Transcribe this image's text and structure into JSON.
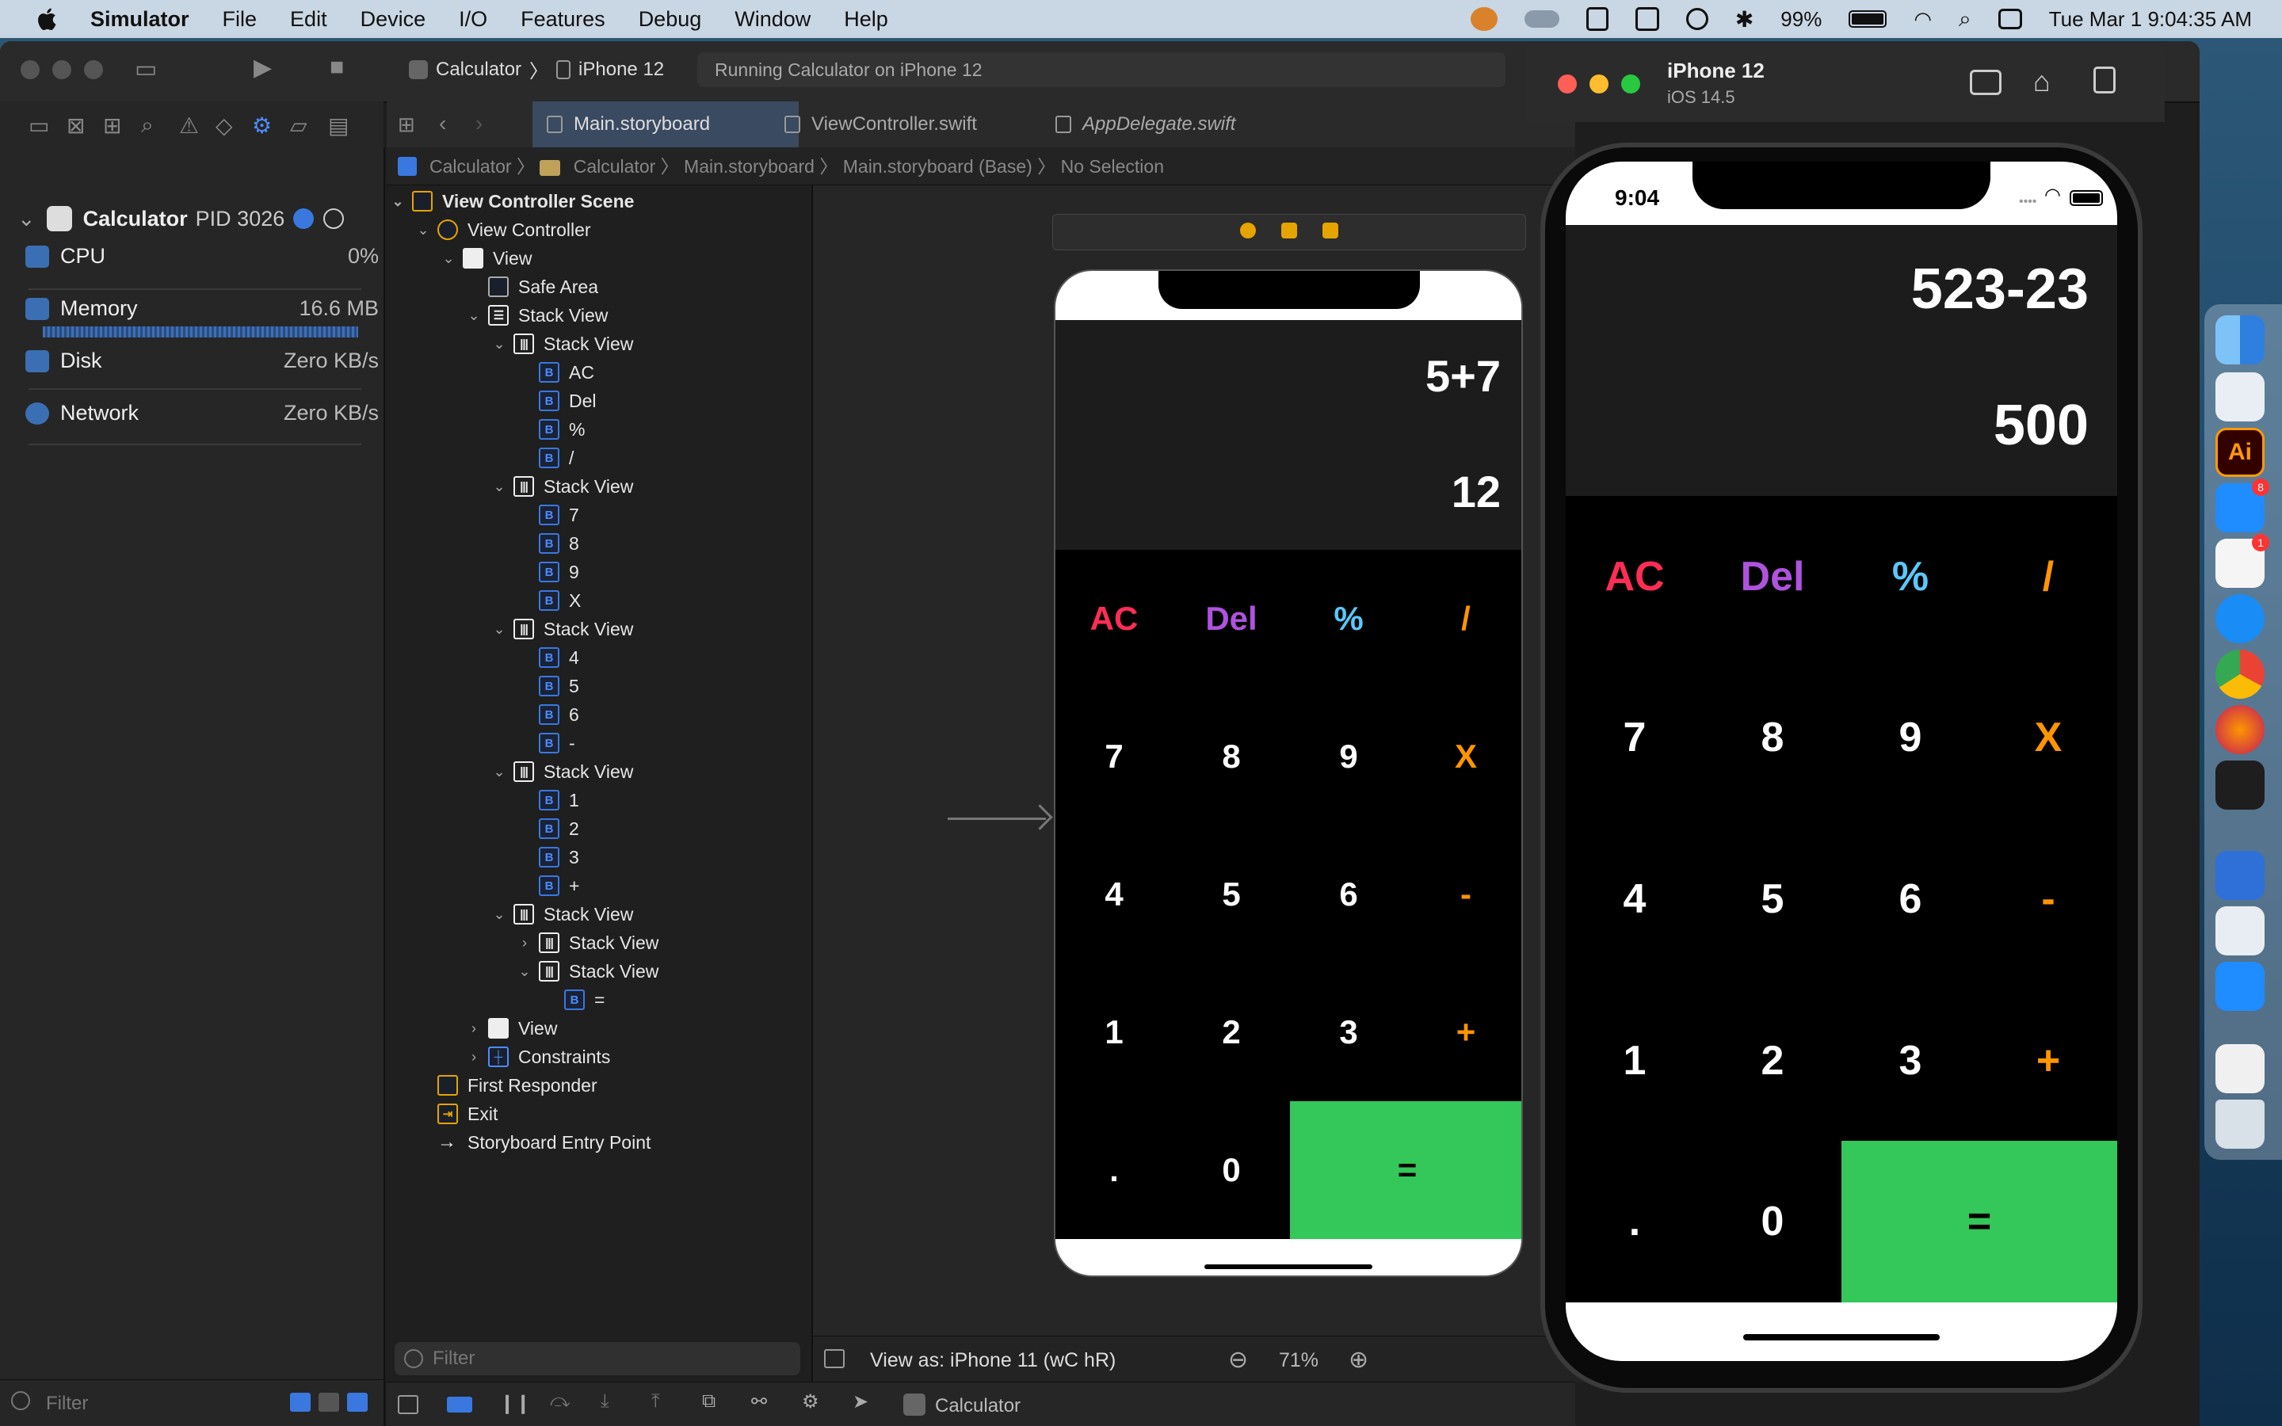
{
  "menubar": {
    "app_name": "Simulator",
    "items": [
      "File",
      "Edit",
      "Device",
      "I/O",
      "Features",
      "Debug",
      "Window",
      "Help"
    ],
    "battery": "99%",
    "datetime": "Tue Mar 1  9:04:35 AM"
  },
  "xcode": {
    "scheme": "Calculator",
    "destination": "iPhone 12",
    "activity": "Running Calculator on iPhone 12",
    "tabs": [
      {
        "label": "Main.storyboard"
      },
      {
        "label": "ViewController.swift"
      },
      {
        "label": "AppDelegate.swift"
      }
    ],
    "breadcrumb": [
      "Calculator",
      "Calculator",
      "Main.storyboard",
      "Main.storyboard (Base)",
      "No Selection"
    ],
    "debug": {
      "process": "Calculator",
      "pid": "PID 3026",
      "gauges": [
        {
          "name": "CPU",
          "value": "0%"
        },
        {
          "name": "Memory",
          "value": "16.6 MB"
        },
        {
          "name": "Disk",
          "value": "Zero KB/s"
        },
        {
          "name": "Network",
          "value": "Zero KB/s"
        }
      ]
    },
    "filter_placeholder": "Filter",
    "outline": {
      "scene": "View Controller Scene",
      "view_controller": "View Controller",
      "view": "View",
      "safe_area": "Safe Area",
      "stack_view": "Stack View",
      "rows": [
        [
          "AC",
          "Del",
          "%",
          "/"
        ],
        [
          "7",
          "8",
          "9",
          "X"
        ],
        [
          "4",
          "5",
          "6",
          "-"
        ],
        [
          "1",
          "2",
          "3",
          "+"
        ]
      ],
      "equals": "=",
      "constraints": "Constraints",
      "first_responder": "First Responder",
      "exit": "Exit",
      "entry_point": "Storyboard Entry Point",
      "b_glyph": "B"
    },
    "canvas": {
      "expression": "5+7",
      "result": "12",
      "view_as": "View as: iPhone 11 (wC hR)",
      "zoom": "71%"
    },
    "debug_bar_target": "Calculator"
  },
  "simulator": {
    "device": "iPhone 12",
    "os": "iOS 14.5",
    "time": "9:04",
    "expression": "523-23",
    "result": "500"
  },
  "keypad": {
    "rows": [
      [
        {
          "label": "AC",
          "color": "#ff2d55"
        },
        {
          "label": "Del",
          "color": "#af52de"
        },
        {
          "label": "%",
          "color": "#5ac8fa"
        },
        {
          "label": "/",
          "color": "#ff9500"
        }
      ],
      [
        {
          "label": "7",
          "color": "#ffffff"
        },
        {
          "label": "8",
          "color": "#ffffff"
        },
        {
          "label": "9",
          "color": "#ffffff"
        },
        {
          "label": "X",
          "color": "#ff9500"
        }
      ],
      [
        {
          "label": "4",
          "color": "#ffffff"
        },
        {
          "label": "5",
          "color": "#ffffff"
        },
        {
          "label": "6",
          "color": "#ffffff"
        },
        {
          "label": "-",
          "color": "#ff9500"
        }
      ],
      [
        {
          "label": "1",
          "color": "#ffffff"
        },
        {
          "label": "2",
          "color": "#ffffff"
        },
        {
          "label": "3",
          "color": "#ffffff"
        },
        {
          "label": "+",
          "color": "#ff9500"
        }
      ]
    ],
    "bottom": {
      "dot": ".",
      "zero": "0",
      "equals": "="
    },
    "equals_color": "#34c759"
  },
  "dock": {
    "badges": [
      "8",
      "1"
    ]
  }
}
